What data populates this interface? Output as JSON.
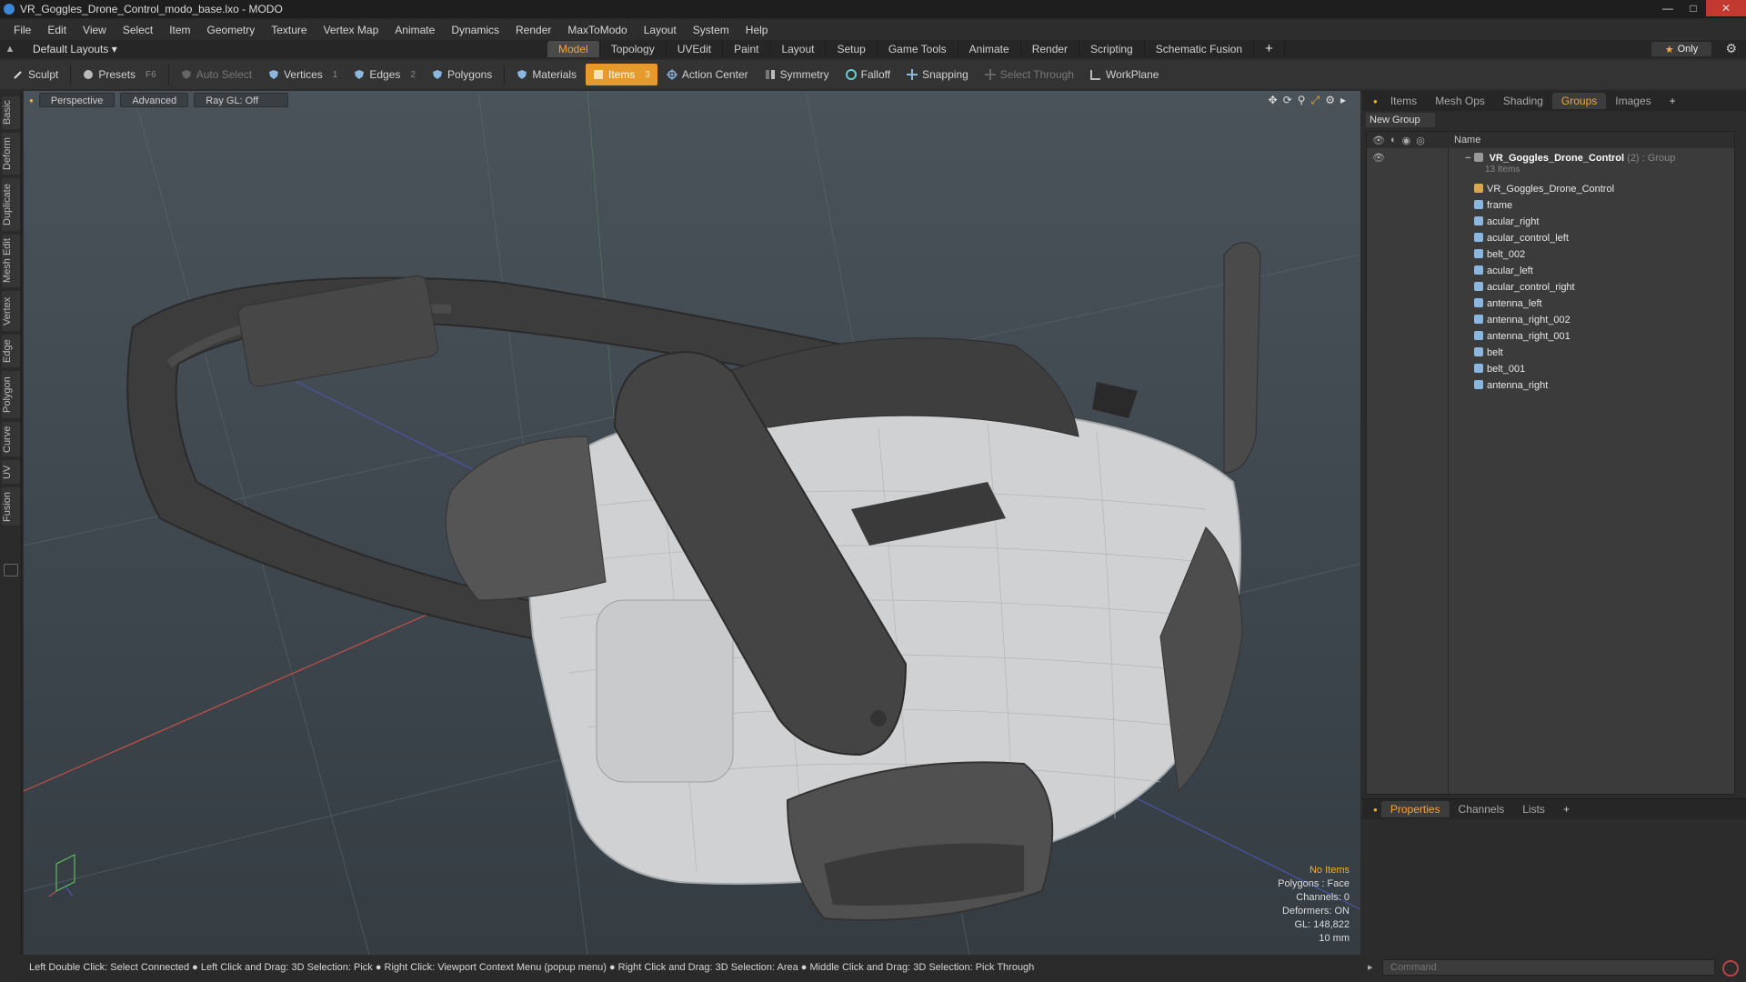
{
  "window": {
    "title": "VR_Goggles_Drone_Control_modo_base.lxo - MODO"
  },
  "menu": [
    "File",
    "Edit",
    "View",
    "Select",
    "Item",
    "Geometry",
    "Texture",
    "Vertex Map",
    "Animate",
    "Dynamics",
    "Render",
    "MaxToModo",
    "Layout",
    "System",
    "Help"
  ],
  "layout_row": {
    "layouts_label": "Default Layouts ▾",
    "tabs": [
      "Model",
      "Topology",
      "UVEdit",
      "Paint",
      "Layout",
      "Setup",
      "Game Tools",
      "Animate",
      "Render",
      "Scripting",
      "Schematic Fusion"
    ],
    "active_tab": "Model",
    "plus": "+",
    "only_label": "Only"
  },
  "toolbar": {
    "sculpt": "Sculpt",
    "presets": "Presets",
    "presets_key": "F6",
    "auto_select": "Auto Select",
    "vertices": "Vertices",
    "vertices_count": "1",
    "edges": "Edges",
    "edges_count": "2",
    "polygons": "Polygons",
    "materials": "Materials",
    "items": "Items",
    "items_count": "3",
    "action_center": "Action Center",
    "symmetry": "Symmetry",
    "falloff": "Falloff",
    "snapping": "Snapping",
    "select_through": "Select Through",
    "workplane": "WorkPlane"
  },
  "left_tabs": [
    "Basic",
    "Deform",
    "Duplicate",
    "Mesh Edit",
    "Vertex",
    "Edge",
    "Polygon",
    "Curve",
    "UV",
    "Fusion"
  ],
  "viewport": {
    "perspective": "Perspective",
    "advanced": "Advanced",
    "raygl": "Ray GL: Off",
    "stats": {
      "no_items": "No Items",
      "polygons": "Polygons : Face",
      "channels": "Channels: 0",
      "deformers": "Deformers: ON",
      "gl": "GL: 148,822",
      "scale": "10 mm"
    }
  },
  "statusbar": "Left Double Click: Select Connected ● Left Click and Drag: 3D Selection: Pick ● Right Click: Viewport Context Menu (popup menu) ● Right Click and Drag: 3D Selection: Area ● Middle Click and Drag: 3D Selection: Pick Through",
  "right_panel": {
    "tabs": [
      "Items",
      "Mesh Ops",
      "Shading",
      "Groups",
      "Images"
    ],
    "active_tab": "Groups",
    "plus": "+",
    "new_group": "New Group",
    "name_header": "Name",
    "group": {
      "name": "VR_Goggles_Drone_Control",
      "suffix": "(2) : Group",
      "count": "13 Items"
    },
    "items": [
      "VR_Goggles_Drone_Control",
      "frame",
      "acular_right",
      "acular_control_left",
      "belt_002",
      "acular_left",
      "acular_control_right",
      "antenna_left",
      "antenna_right_002",
      "antenna_right_001",
      "belt",
      "belt_001",
      "antenna_right"
    ]
  },
  "bottom_panel": {
    "tabs": [
      "Properties",
      "Channels",
      "Lists"
    ],
    "active_tab": "Properties",
    "plus": "+",
    "command_placeholder": "Command"
  },
  "colors": {
    "accent": "#f2a63c",
    "viewport_bg": "#414a51",
    "active_tool": "#e59a2b"
  }
}
